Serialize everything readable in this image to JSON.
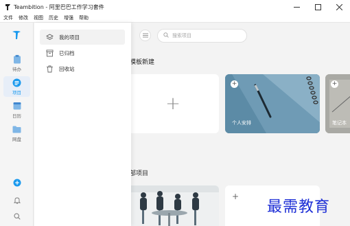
{
  "window": {
    "app_name": "Teambition",
    "title": "Teambition - 阿里巴巴工作学习套件",
    "controls": [
      "minimize",
      "maximize",
      "close"
    ]
  },
  "menubar": {
    "items": [
      "文件",
      "修改",
      "视图",
      "历史",
      "增强",
      "帮助"
    ]
  },
  "rail": {
    "items": [
      {
        "label": "待办",
        "icon": "todo-icon"
      },
      {
        "label": "项目",
        "icon": "project-icon",
        "active": true
      },
      {
        "label": "日历",
        "icon": "calendar-icon"
      },
      {
        "label": "网盘",
        "icon": "folder-icon"
      }
    ],
    "bottom": [
      "add-icon",
      "bell-icon",
      "search-icon"
    ]
  },
  "panel": {
    "items": [
      {
        "label": "我的项目",
        "icon": "layers-icon",
        "active": true
      },
      {
        "label": "已归档",
        "icon": "archive-icon"
      },
      {
        "label": "回收站",
        "icon": "trash-icon"
      }
    ]
  },
  "main": {
    "search_placeholder": "搜索项目",
    "template_section": "模板新建",
    "all_section": "部项目",
    "template_cards": [
      {
        "label": "个人安排"
      },
      {
        "label": "笔记本"
      }
    ]
  },
  "colors": {
    "accent": "#1b9aee",
    "card_personal": "#5c8ba6",
    "watermark": "#1e2fd6"
  },
  "watermark": "最需教育"
}
